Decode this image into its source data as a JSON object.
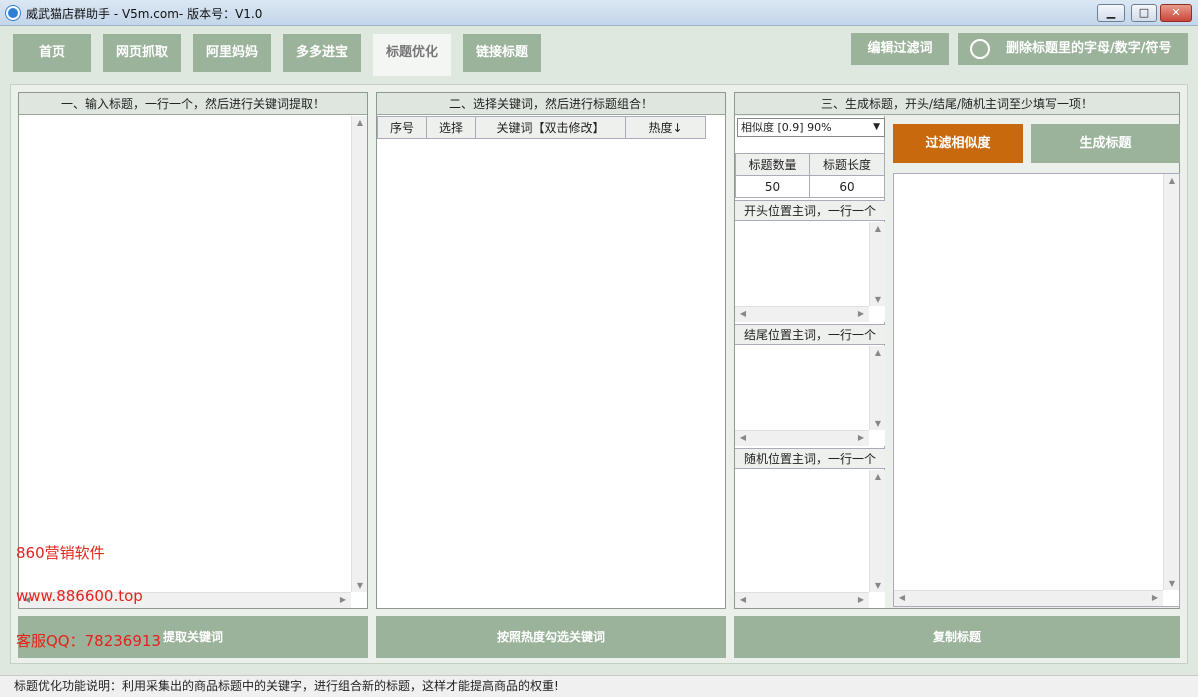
{
  "window": {
    "title": "威武猫店群助手 - V5m.com- 版本号：V1.0",
    "min_glyph": "▁",
    "max_glyph": "□",
    "close_glyph": "✕"
  },
  "tabs": [
    {
      "label": "首页"
    },
    {
      "label": "网页抓取"
    },
    {
      "label": "阿里妈妈"
    },
    {
      "label": "多多进宝"
    },
    {
      "label": "标题优化"
    },
    {
      "label": "链接标题"
    }
  ],
  "toolbar": {
    "edit_filter_label": "编辑过滤词",
    "remove_chars_label": "删除标题里的字母/数字/符号"
  },
  "panel1": {
    "header": "一、输入标题，一行一个，然后进行关键词提取！",
    "button_label": "提取关键词"
  },
  "panel2": {
    "header": "二、选择关键词，然后进行标题组合！",
    "columns": [
      "序号",
      "选择",
      "关键词【双击修改】",
      "热度↓"
    ],
    "button_label": "按照热度勾选关键词"
  },
  "panel3": {
    "header": "三、生成标题，开头/结尾/随机主词至少填写一项！",
    "similarity_select": "相似度 [0.9] 90%",
    "filter_button": "过滤相似度",
    "generate_button": "生成标题",
    "count_label": "标题数量",
    "length_label": "标题长度",
    "count_value": "50",
    "length_value": "60",
    "start_label": "开头位置主词，一行一个",
    "end_label": "结尾位置主词，一行一个",
    "random_label": "随机位置主词，一行一个",
    "button_label": "复制标题"
  },
  "watermark": {
    "line1": "860营销软件",
    "line2": "www.886600.top",
    "line3": "客服QQ：78236913"
  },
  "status": {
    "text": "标题优化功能说明：利用采集出的商品标题中的关键字，进行组合新的标题，这样才能提高商品的权重!"
  },
  "colors": {
    "tab_green": "#9bb39b",
    "filter_orange": "#c8690e",
    "watermark_red": "#e2231a"
  }
}
